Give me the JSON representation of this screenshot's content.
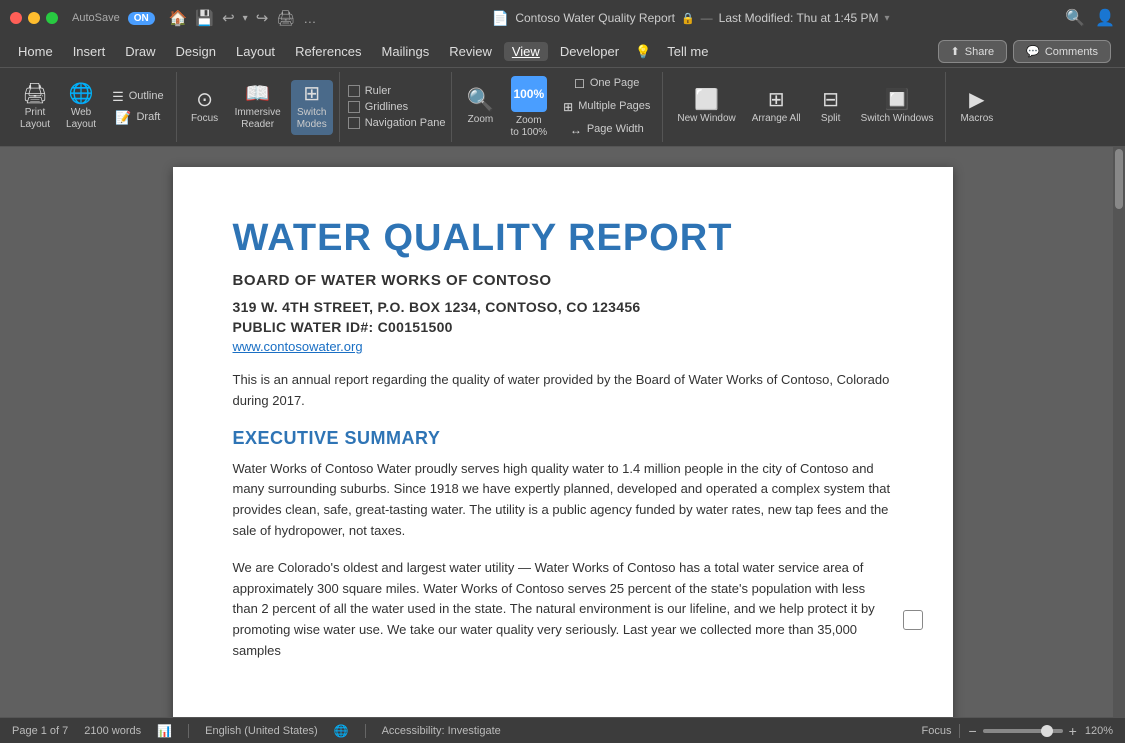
{
  "titlebar": {
    "autosave_label": "AutoSave",
    "autosave_state": "ON",
    "title": "Contoso Water Quality Report",
    "modified": "Last Modified: Thu at 1:45 PM",
    "icons": [
      "home",
      "save",
      "undo",
      "redo",
      "print",
      "more"
    ]
  },
  "menubar": {
    "items": [
      "Home",
      "Insert",
      "Draw",
      "Design",
      "Layout",
      "References",
      "Mailings",
      "Review",
      "View",
      "Developer",
      "Tell me"
    ]
  },
  "toolbar": {
    "view_group": {
      "print_layout": {
        "label": "Print\nLayout",
        "icon": "🖨"
      },
      "web_layout": {
        "label": "Web\nLayout",
        "icon": "🌐"
      },
      "outline": {
        "label": "Outline",
        "icon": "☰"
      },
      "draft": {
        "label": "Draft",
        "icon": "📄"
      },
      "focus": {
        "label": "Focus",
        "icon": "⊙"
      },
      "immersive_reader": {
        "label": "Immersive\nReader",
        "icon": "📖"
      },
      "switch_modes": {
        "label": "Switch\nModes",
        "icon": "⊞"
      }
    },
    "show_group": {
      "ruler": "Ruler",
      "gridlines": "Gridlines",
      "navigation_pane": "Navigation Pane"
    },
    "zoom_group": {
      "zoom_label": "Zoom",
      "zoom100_label": "Zoom\nto 100%",
      "one_page": "One Page",
      "multiple_pages": "Multiple Pages",
      "page_width": "Page Width"
    },
    "window_group": {
      "new_window": "New\nWindow",
      "arrange_all": "Arrange\nAll",
      "split": "Split",
      "switch_windows": "Switch\nWindows"
    },
    "macros": {
      "label": "Macros"
    },
    "share_btn": "⬆ Share",
    "comments_btn": "💬 Comments"
  },
  "document": {
    "title": "WATER QUALITY REPORT",
    "subtitle": "BOARD OF WATER WORKS OF CONTOSO",
    "address1": "319 W. 4TH STREET, P.O. BOX 1234, CONTOSO, CO 123456",
    "address2": "PUBLIC WATER ID#: C00151500",
    "link": "www.contosowater.org",
    "intro": "This is an annual report regarding the quality of water provided by the Board of Water Works of Contoso, Colorado during 2017.",
    "section1_title": "EXECUTIVE SUMMARY",
    "section1_para1": "Water Works of Contoso Water proudly serves high quality water to 1.4 million people in the city of Contoso and many surrounding suburbs. Since 1918 we have expertly planned, developed and operated a complex system that provides clean, safe, great-tasting water. The utility is a public agency funded by water rates, new tap fees and the sale of hydropower, not taxes.",
    "section1_para2": "We are Colorado's oldest and largest water utility — Water Works of Contoso has a total water service area of approximately 300 square miles. Water Works of Contoso serves 25 percent of the state's population with less than 2 percent of all the water used in the state. The natural environment is our lifeline, and we help protect it by promoting wise water use. We take our water quality very seriously. Last year we collected more than 35,000 samples"
  },
  "statusbar": {
    "page_info": "Page 1 of 7",
    "word_count": "2100 words",
    "language": "English (United States)",
    "accessibility": "Accessibility: Investigate",
    "focus": "Focus",
    "zoom_percent": "120%",
    "zoom_minus": "−",
    "zoom_plus": "+"
  }
}
